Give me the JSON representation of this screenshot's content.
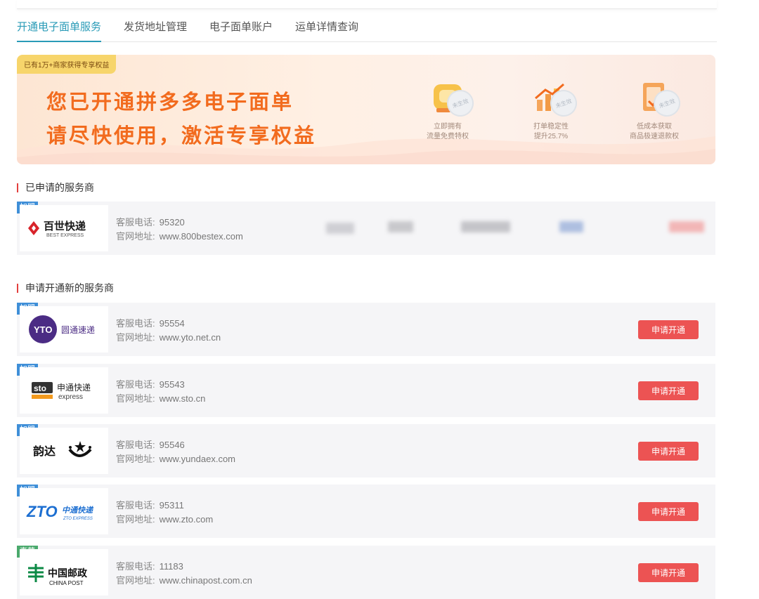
{
  "tabs": [
    {
      "label": "开通电子面单服务",
      "active": true
    },
    {
      "label": "发货地址管理",
      "active": false
    },
    {
      "label": "电子面单账户",
      "active": false
    },
    {
      "label": "运单详情查询",
      "active": false
    }
  ],
  "banner": {
    "badge": "已有1万+商家获得专享权益",
    "line1": "您已开通拼多多电子面单",
    "line2": "请尽快使用，激活专享权益",
    "benefits": [
      {
        "line1": "立即拥有",
        "line2": "流量免费特权",
        "stamp": "未生效",
        "icon": "traffic-privilege-icon",
        "color": "#f5b43a"
      },
      {
        "line1": "打单稳定性",
        "line2": "提升25.7%",
        "stamp": "未生效",
        "icon": "stability-chart-icon",
        "color": "#f29a45"
      },
      {
        "line1": "低成本获取",
        "line2": "商品极速退款权",
        "stamp": "未生效",
        "icon": "refund-ticket-icon",
        "color": "#f28b52"
      }
    ]
  },
  "applied_section": {
    "title": "已申请的服务商",
    "providers": [
      {
        "tag": "加盟",
        "logo_text": "百世快递",
        "logo_sub": "BEST EXPRESS",
        "phone_label": "客服电话:",
        "phone": "95320",
        "site_label": "官网地址:",
        "site": "www.800bestex.com"
      }
    ]
  },
  "new_section": {
    "title": "申请开通新的服务商",
    "apply_label": "申请开通",
    "providers": [
      {
        "tag": "加盟",
        "tag_type": "franchise",
        "logo_text": "圆通速递",
        "phone_label": "客服电话:",
        "phone": "95554",
        "site_label": "官网地址:",
        "site": "www.yto.net.cn"
      },
      {
        "tag": "加盟",
        "tag_type": "franchise",
        "logo_text": "申通快递",
        "logo_sub": "express",
        "phone_label": "客服电话:",
        "phone": "95543",
        "site_label": "官网地址:",
        "site": "www.sto.cn"
      },
      {
        "tag": "加盟",
        "tag_type": "franchise",
        "logo_text": "韵达",
        "phone_label": "客服电话:",
        "phone": "95546",
        "site_label": "官网地址:",
        "site": "www.yundaex.com"
      },
      {
        "tag": "加盟",
        "tag_type": "franchise",
        "logo_text": "中通快递",
        "logo_sub": "ZTO EXPRESS",
        "phone_label": "客服电话:",
        "phone": "95311",
        "site_label": "官网地址:",
        "site": "www.zto.com"
      },
      {
        "tag": "直营",
        "tag_type": "direct",
        "logo_text": "中国邮政",
        "logo_sub": "CHINA POST",
        "phone_label": "客服电话:",
        "phone": "11183",
        "site_label": "官网地址:",
        "site": "www.chinapost.com.cn"
      }
    ]
  },
  "colors": {
    "accent": "#2a9bb7",
    "apply_button": "#ec5353",
    "banner_text": "#f26b1e",
    "section_marker": "#e3403e"
  }
}
